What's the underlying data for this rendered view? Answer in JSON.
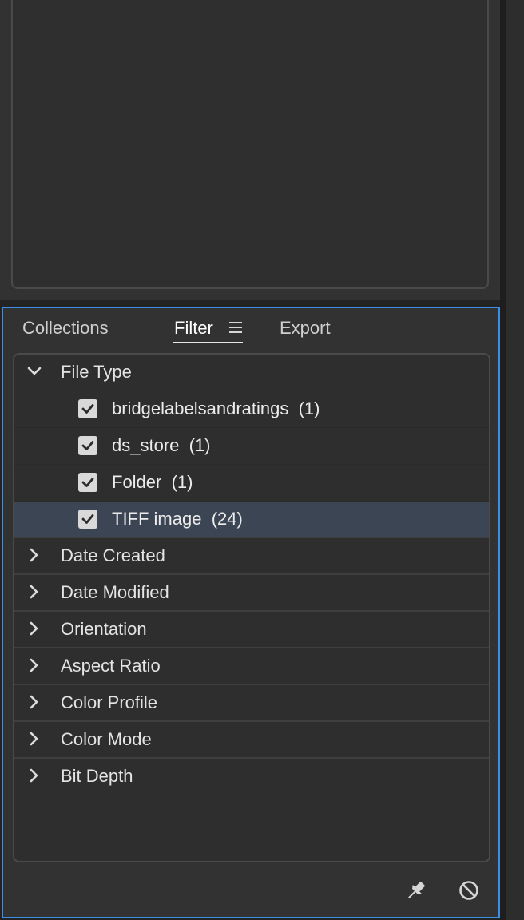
{
  "tabs": [
    {
      "label": "Collections"
    },
    {
      "label": "Filter"
    },
    {
      "label": "Export"
    }
  ],
  "filter": {
    "file_type": {
      "label": "File Type",
      "items": [
        {
          "label": "bridgelabelsandratings",
          "count": "(1)",
          "checked": true
        },
        {
          "label": "ds_store",
          "count": "(1)",
          "checked": true
        },
        {
          "label": "Folder",
          "count": "(1)",
          "checked": true
        },
        {
          "label": "TIFF image",
          "count": "(24)",
          "checked": true
        }
      ]
    },
    "categories": [
      {
        "label": "Date Created"
      },
      {
        "label": "Date Modified"
      },
      {
        "label": "Orientation"
      },
      {
        "label": "Aspect Ratio"
      },
      {
        "label": "Color Profile"
      },
      {
        "label": "Color Mode"
      },
      {
        "label": "Bit Depth"
      }
    ]
  },
  "footer": {
    "icons": [
      "pin-icon",
      "clear-filter-icon"
    ]
  },
  "colors": {
    "accent_border": "#3d8ee6",
    "selected_row": "#3c4553",
    "panel_bg": "#323232"
  }
}
